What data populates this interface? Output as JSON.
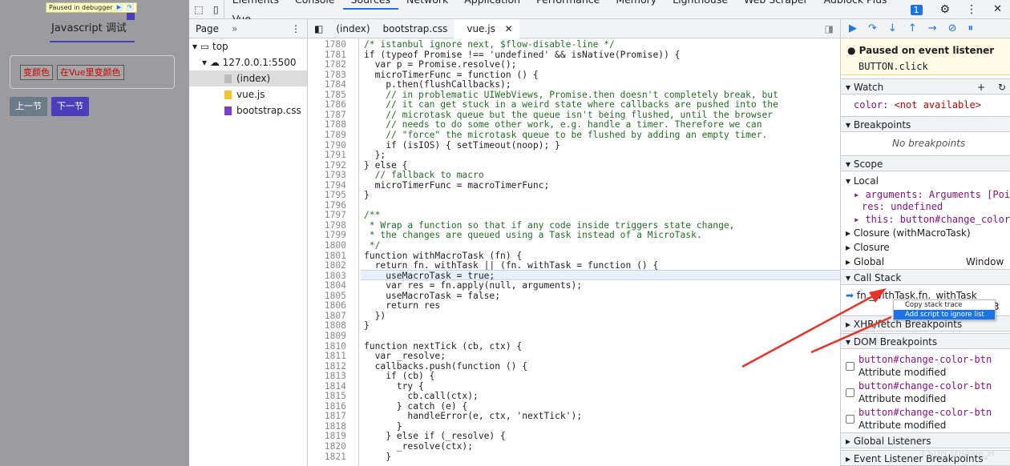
{
  "page": {
    "paused_text": "Paused in debugger",
    "title": "Javascript 调试",
    "btn1": "变颜色",
    "btn2": "在Vue里变颜色",
    "prev": "上一节",
    "next": "下一节"
  },
  "devtools": {
    "tabs": [
      "Elements",
      "Console",
      "Sources",
      "Network",
      "Application",
      "Performance",
      "Memory",
      "Lighthouse",
      "Web Scraper",
      "Adblock Plus",
      "Vue"
    ],
    "badge": "1"
  },
  "nav": {
    "tab": "Page",
    "tree": [
      "top",
      "127.0.0.1:5500",
      "(index)",
      "vue.js",
      "bootstrap.css"
    ]
  },
  "editor": {
    "tabs": [
      "(index)",
      "bootstrap.css",
      "vue.js"
    ],
    "lines": [
      {
        "n": "1780",
        "t": "/* istanbul ignore next, $flow-disable-line */"
      },
      {
        "n": "1781",
        "t": "if (typeof Promise !== 'undefined' && isNative(Promise)) {"
      },
      {
        "n": "1782",
        "t": "  var p = Promise.resolve();"
      },
      {
        "n": "1783",
        "t": "  microTimerFunc = function () {"
      },
      {
        "n": "1784",
        "t": "    p.then(flushCallbacks);"
      },
      {
        "n": "1785",
        "t": "    // in problematic UIWebViews, Promise.then doesn't completely break, but"
      },
      {
        "n": "1786",
        "t": "    // it can get stuck in a weird state where callbacks are pushed into the"
      },
      {
        "n": "1787",
        "t": "    // microtask queue but the queue isn't being flushed, until the browser"
      },
      {
        "n": "1788",
        "t": "    // needs to do some other work, e.g. handle a timer. Therefore we can"
      },
      {
        "n": "1789",
        "t": "    // \"force\" the microtask queue to be flushed by adding an empty timer."
      },
      {
        "n": "1790",
        "t": "    if (isIOS) { setTimeout(noop); }"
      },
      {
        "n": "1791",
        "t": "  };"
      },
      {
        "n": "1792",
        "t": "} else {"
      },
      {
        "n": "1793",
        "t": "  // fallback to macro"
      },
      {
        "n": "1794",
        "t": "  microTimerFunc = macroTimerFunc;"
      },
      {
        "n": "1795",
        "t": "}"
      },
      {
        "n": "1796",
        "t": ""
      },
      {
        "n": "1797",
        "t": "/**"
      },
      {
        "n": "1798",
        "t": " * Wrap a function so that if any code inside triggers state change,"
      },
      {
        "n": "1799",
        "t": " * the changes are queued using a Task instead of a MicroTask."
      },
      {
        "n": "1800",
        "t": " */"
      },
      {
        "n": "1801",
        "t": "function withMacroTask (fn) {"
      },
      {
        "n": "1802",
        "t": "  return fn._withTask || (fn._withTask = function () {"
      },
      {
        "n": "1803",
        "t": "    useMacroTask = true;"
      },
      {
        "n": "1804",
        "t": "    var res = fn.apply(null, arguments);"
      },
      {
        "n": "1805",
        "t": "    useMacroTask = false;"
      },
      {
        "n": "1806",
        "t": "    return res"
      },
      {
        "n": "1807",
        "t": "  })"
      },
      {
        "n": "1808",
        "t": "}"
      },
      {
        "n": "1809",
        "t": ""
      },
      {
        "n": "1810",
        "t": "function nextTick (cb, ctx) {"
      },
      {
        "n": "1811",
        "t": "  var _resolve;"
      },
      {
        "n": "1812",
        "t": "  callbacks.push(function () {"
      },
      {
        "n": "1813",
        "t": "    if (cb) {"
      },
      {
        "n": "1814",
        "t": "      try {"
      },
      {
        "n": "1815",
        "t": "        cb.call(ctx);"
      },
      {
        "n": "1816",
        "t": "      } catch (e) {"
      },
      {
        "n": "1817",
        "t": "        handleError(e, ctx, 'nextTick');"
      },
      {
        "n": "1818",
        "t": "      }"
      },
      {
        "n": "1819",
        "t": "    } else if (_resolve) {"
      },
      {
        "n": "1820",
        "t": "      _resolve(ctx);"
      },
      {
        "n": "1821",
        "t": "    }"
      }
    ]
  },
  "sidebar": {
    "paused_title": "Paused on event listener",
    "paused_sub": "BUTTON.click",
    "watch": "Watch",
    "watch_expr": "color: ",
    "watch_val": "<not available>",
    "breakpoints": "Breakpoints",
    "no_breakpoints": "No breakpoints",
    "scope": "Scope",
    "local": "Local",
    "arguments": "arguments: Arguments [Poi…",
    "res": "res: undefined",
    "this": "this: button#change_color_…",
    "closure1": "Closure (withMacroTask)",
    "closure2": "Closure",
    "global": "Global",
    "global_val": "Window",
    "callstack": "Call Stack",
    "frame": "fn._withTask.fn._withTask",
    "frame_line": "3",
    "ctx_copy": "Copy stack trace",
    "ctx_add": "Add script to ignore list",
    "xhr": "XHR/fetch Breakpoints",
    "dom": "DOM Breakpoints",
    "dom_items": [
      {
        "el": "button#change-color-btn",
        "kind": "Attribute modified"
      },
      {
        "el": "button#change-color-btn",
        "kind": "Attribute modified"
      },
      {
        "el": "button#change-color-btn",
        "kind": "Attribute modified"
      }
    ],
    "global_listeners": "Global Listeners",
    "event_listener_bp": "Event Listener Breakpoints"
  },
  "watermark": "CSDN @Boale_H"
}
